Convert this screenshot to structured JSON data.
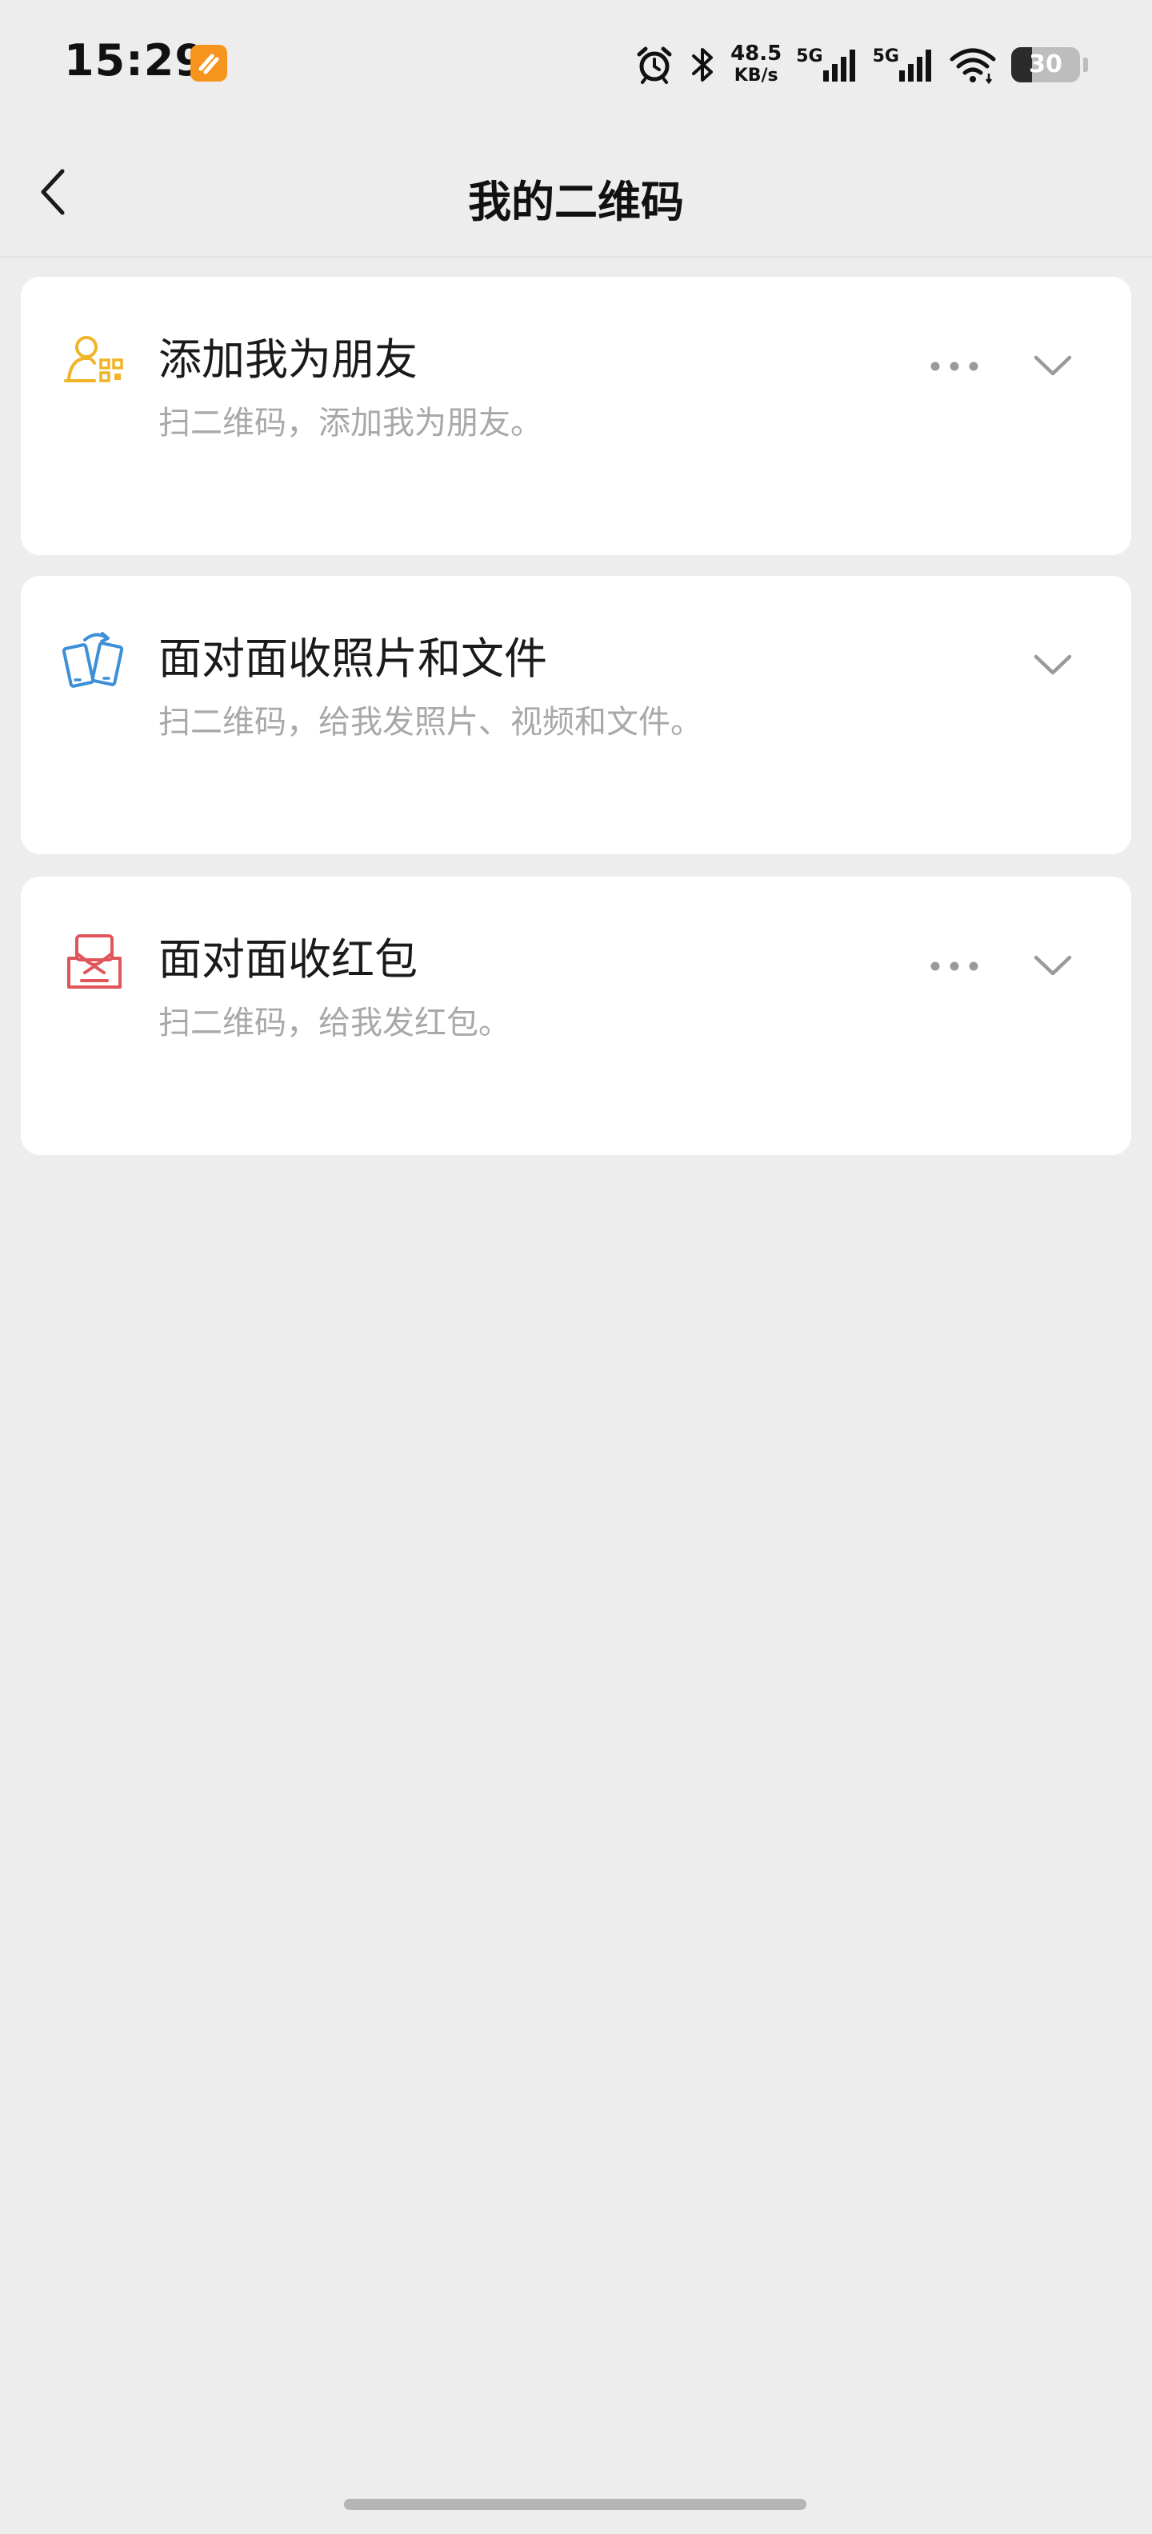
{
  "status_bar": {
    "time": "15:29",
    "net_speed_value": "48.5",
    "net_speed_unit": "KB/s",
    "signal1_label": "5G",
    "signal2_label": "5G",
    "battery_level": "30",
    "battery_fraction": 0.3
  },
  "header": {
    "title": "我的二维码"
  },
  "cards": [
    {
      "title": "添加我为朋友",
      "subtitle": "扫二维码，添加我为朋友。",
      "icon": "user-qrcode-icon",
      "icon_color": "#f0b429",
      "has_more": true
    },
    {
      "title": "面对面收照片和文件",
      "subtitle": "扫二维码，给我发照片、视频和文件。",
      "icon": "phone-transfer-icon",
      "icon_color": "#3d8fd8",
      "has_more": false
    },
    {
      "title": "面对面收红包",
      "subtitle": "扫二维码，给我发红包。",
      "icon": "red-packet-icon",
      "icon_color": "#e0555a",
      "has_more": true
    }
  ],
  "colors": {
    "background": "#ededed",
    "card": "#ffffff",
    "subtitle": "#a8a8a8",
    "app_badge": "#f7941d"
  }
}
